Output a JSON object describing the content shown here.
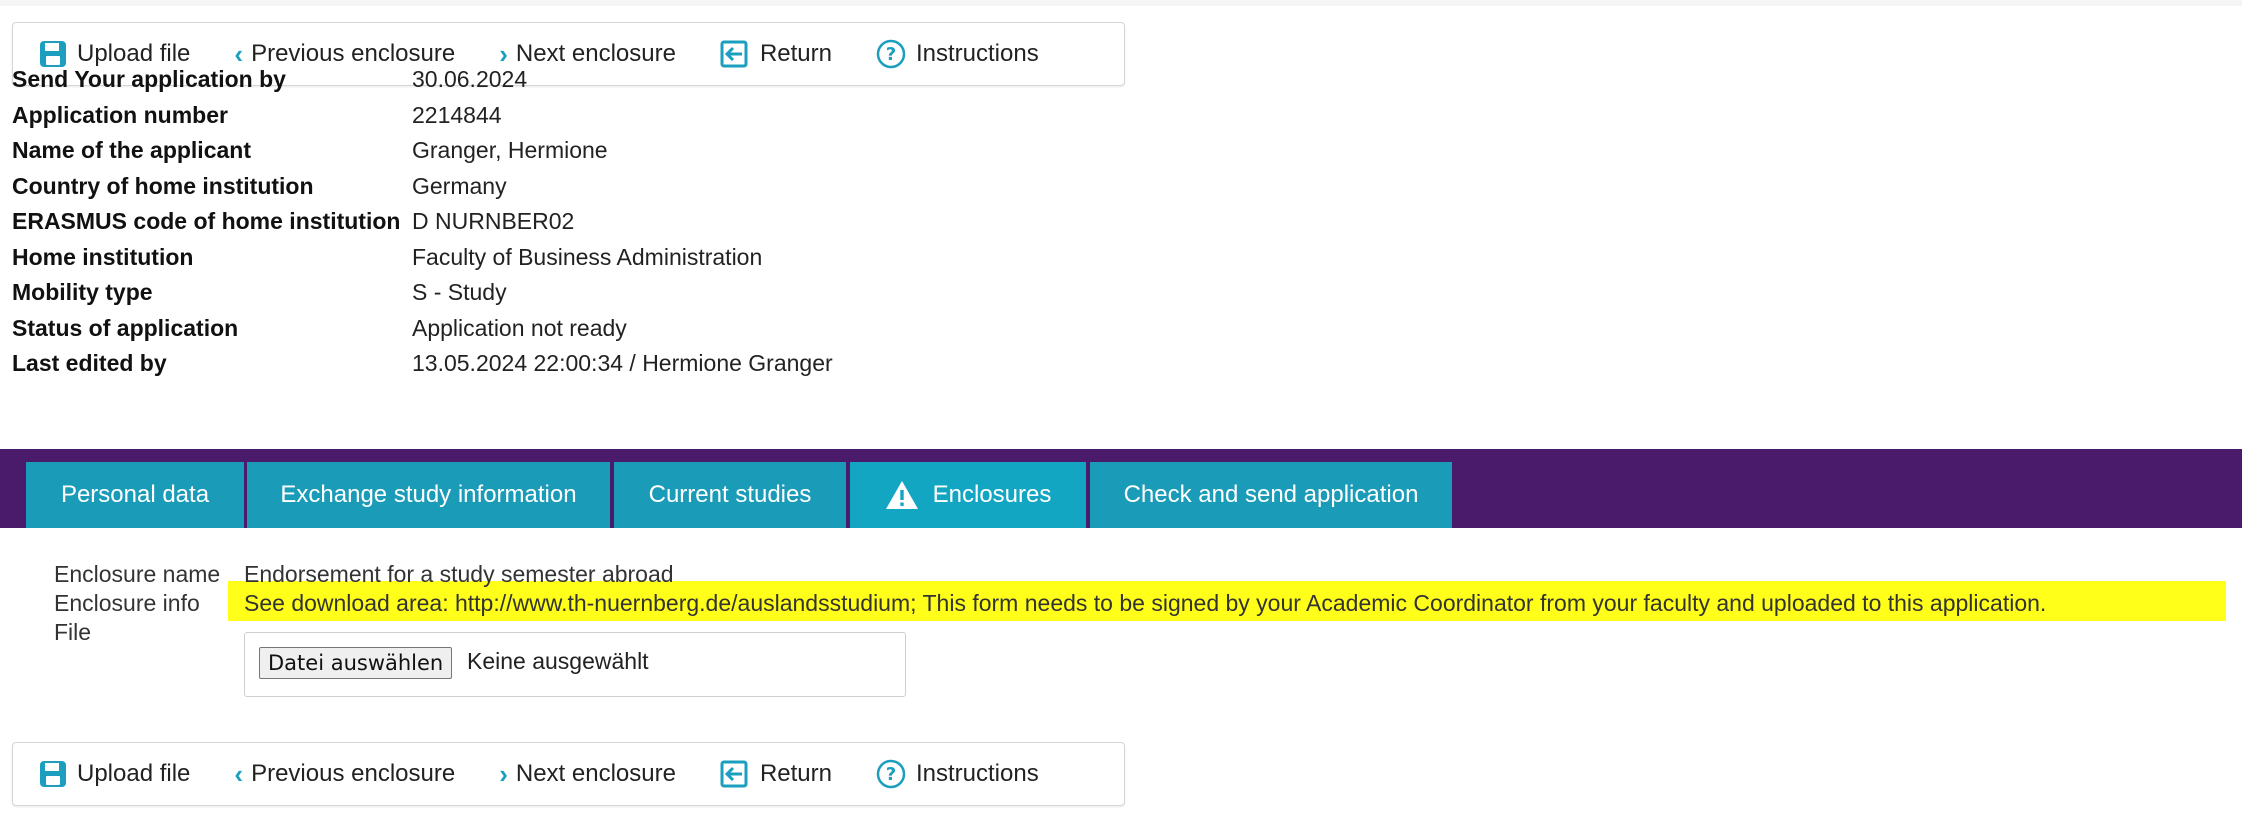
{
  "toolbar": {
    "upload": "Upload file",
    "previous": "Previous enclosure",
    "next": "Next enclosure",
    "return": "Return",
    "instructions": "Instructions"
  },
  "info": [
    {
      "label": "Send Your application by",
      "value": "30.06.2024"
    },
    {
      "label": "Application number",
      "value": "2214844"
    },
    {
      "label": "Name of the applicant",
      "value": "Granger, Hermione"
    },
    {
      "label": "Country of home institution",
      "value": "Germany"
    },
    {
      "label": "ERASMUS code of home institution",
      "value": "D NURNBER02"
    },
    {
      "label": "Home institution",
      "value": "Faculty of Business Administration"
    },
    {
      "label": "Mobility type",
      "value": "S - Study"
    },
    {
      "label": "Status of application",
      "value": "Application not ready"
    },
    {
      "label": "Last edited by",
      "value": "13.05.2024 22:00:34 / Hermione Granger"
    }
  ],
  "tabs": [
    {
      "label": "Personal data"
    },
    {
      "label": "Exchange study information"
    },
    {
      "label": "Current studies"
    },
    {
      "label": "Enclosures"
    },
    {
      "label": "Check and send application"
    }
  ],
  "enclosure": {
    "name_label": "Enclosure name",
    "name_value": "Endorsement for a study semester abroad",
    "info_label": "Enclosure info",
    "info_value": "See download area: http://www.th-nuernberg.de/auslandsstudium; This form needs to be signed by your Academic Coordinator from your faculty and uploaded to this application.",
    "file_label": "File",
    "file_button": "Datei auswählen",
    "file_status": "Keine ausgewählt"
  },
  "colors": {
    "accent": "#1a9bb7",
    "tab_band": "#4a1b6b",
    "highlight": "#ffff1a"
  }
}
